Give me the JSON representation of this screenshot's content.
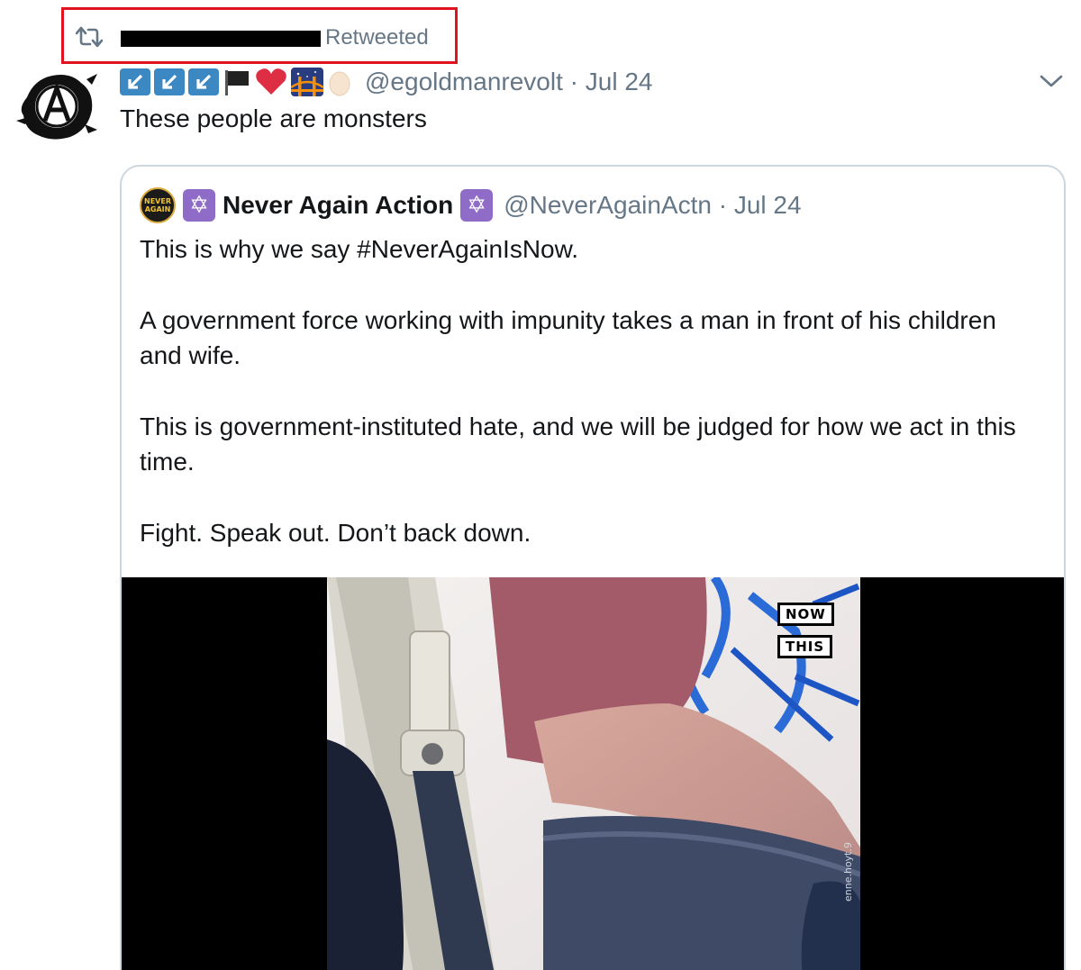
{
  "retweet": {
    "label": "Retweeted",
    "icon": "retweet-icon",
    "highlight_color": "#e0141e"
  },
  "tweet": {
    "handle": "@egoldmanrevolt",
    "separator": "·",
    "date": "Jul 24",
    "text": "These people are monsters",
    "name_emojis": [
      "arrow-down-left-icon",
      "arrow-down-left-icon",
      "arrow-down-left-icon",
      "black-flag-icon",
      "red-heart-icon",
      "bridge-at-night-icon",
      "egg-icon"
    ]
  },
  "quoted": {
    "avatar_text": "NEVER AGAIN",
    "name": "Never Again Action",
    "handle": "@NeverAgainActn",
    "date": "Jul 24",
    "paragraphs": [
      "This is why we say #NeverAgainIsNow.",
      "A government force working with impunity takes a man in front of his children and wife.",
      "This is government-instituted hate, and we will be judged for how we act in this time.",
      "Fight. Speak out. Don’t back down."
    ],
    "video": {
      "logo_line1": "NOW",
      "logo_line2": "THIS",
      "watermark": "enne.hoyt.9"
    }
  },
  "colors": {
    "secondary_text": "#657786",
    "primary_text": "#14171a",
    "border": "#ccd6dd",
    "emoji_blue": "#3b88c3",
    "star_purple": "#8e6cc8"
  }
}
